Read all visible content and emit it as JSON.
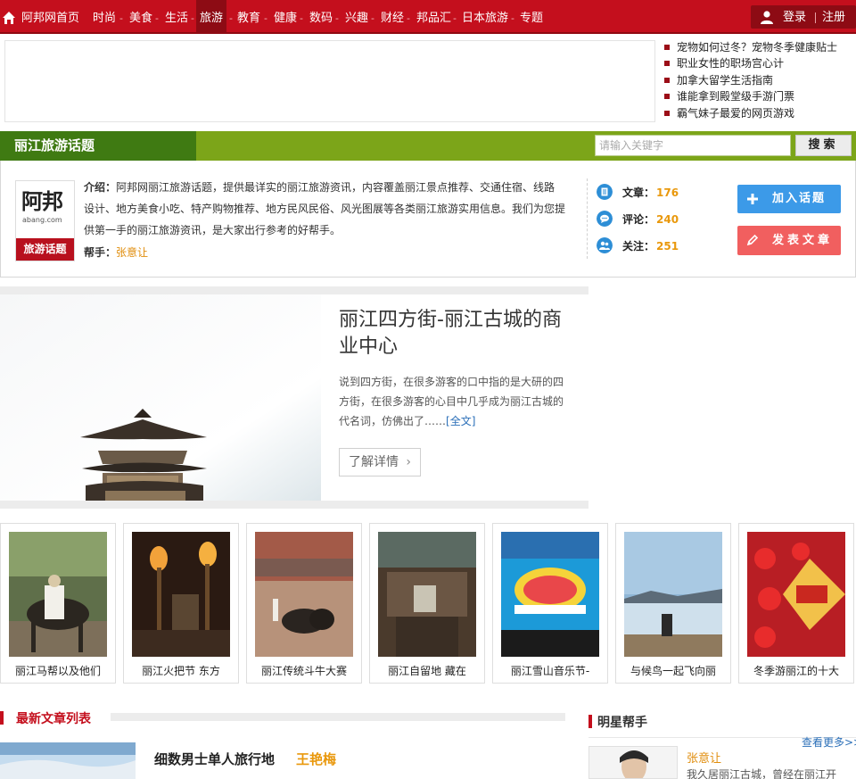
{
  "nav": {
    "home": "阿邦网首页",
    "items": [
      "时尚",
      "美食",
      "生活",
      "旅游",
      "教育",
      "健康",
      "数码",
      "兴趣",
      "财经",
      "邦品汇",
      "日本旅游",
      "专题"
    ],
    "active": "旅游",
    "separator": "-",
    "login": "登录",
    "register": "注册"
  },
  "news": [
    "宠物如何过冬？宠物冬季健康贴士",
    "职业女性的职场宫心计",
    "加拿大留学生活指南",
    "谁能拿到殿堂级手游门票",
    "霸气妹子最爱的网页游戏"
  ],
  "topic": {
    "title": "丽江旅游话题",
    "search_placeholder": "请输入关键字",
    "search_button": "搜索"
  },
  "intro": {
    "logo_text": "阿邦",
    "logo_sub": "abang.com",
    "logo_badge": "旅游话题",
    "label": "介绍：",
    "text": "阿邦网丽江旅游话题，提供最详实的丽江旅游资讯，内容覆盖丽江景点推荐、交通住宿、线路设计、地方美食小吃、特产购物推荐、地方民风民俗、风光图展等各类丽江旅游实用信息。我们为您提供第一手的丽江旅游资讯，是大家出行参考的好帮手。",
    "helper_label": "帮手：",
    "helper_name": "张意让"
  },
  "stats": [
    {
      "label": "文章：",
      "value": "176",
      "icon": "document-icon"
    },
    {
      "label": "评论：",
      "value": "240",
      "icon": "comment-icon"
    },
    {
      "label": "关注：",
      "value": "251",
      "icon": "followers-icon"
    }
  ],
  "actions": {
    "join": "加入话题",
    "post": "发表文章"
  },
  "feature": {
    "title": "丽江四方街-丽江古城的商业中心",
    "summary": "说到四方街，在很多游客的口中指的是大研的四方街，在很多游客的心目中几乎成为丽江古城的代名词，仿佛出了……",
    "full_link": "[全文]",
    "more": "了解详情",
    "more_chevron": "›"
  },
  "gallery": [
    "丽江马帮以及他们",
    "丽江火把节 东方",
    "丽江传统斗牛大赛",
    "丽江自留地 藏在",
    "丽江雪山音乐节-",
    "与候鸟一起飞向丽",
    "冬季游丽江的十大"
  ],
  "latest": {
    "title": "最新文章列表",
    "article_title": "细数男士单人旅行地",
    "article_author": "王艳梅"
  },
  "stars": {
    "title": "明星帮手",
    "more": "查看更多>>",
    "name": "张意让",
    "desc": "我久居丽江古城，曾经在丽江开"
  },
  "colors": {
    "brand_red": "#c40f1d",
    "topic_green": "#7ca519",
    "accent_orange": "#e9980c",
    "join_blue": "#3c9ae8",
    "post_red": "#f15f5f"
  }
}
